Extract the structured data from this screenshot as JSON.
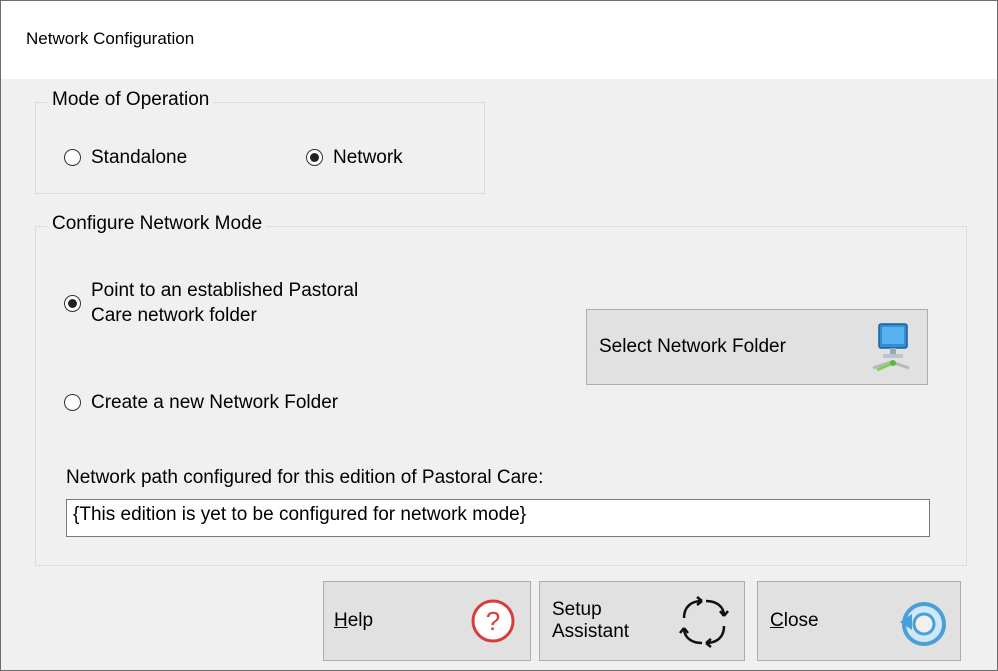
{
  "window": {
    "title": "Network Configuration"
  },
  "mode_group": {
    "legend": "Mode of Operation",
    "options": [
      {
        "label": "Standalone",
        "checked": false
      },
      {
        "label": "Network",
        "checked": true
      }
    ]
  },
  "configure_group": {
    "legend": "Configure Network Mode",
    "options": [
      {
        "label_line1": "Point to an established Pastoral",
        "label_line2": "Care network folder",
        "checked": true
      },
      {
        "label": "Create a new Network Folder",
        "checked": false
      }
    ],
    "select_button_label": "Select Network Folder",
    "path_label": "Network path configured for this edition of Pastoral Care:",
    "path_value": "{This edition is yet to be configured for network mode}"
  },
  "buttons": {
    "help": {
      "mnemonic": "H",
      "rest": "elp",
      "icon": "help-icon"
    },
    "setup": {
      "line1": "Setup",
      "line2": "Assistant",
      "icon": "refresh-arrows-icon"
    },
    "close": {
      "mnemonic": "C",
      "rest": "lose",
      "icon": "close-return-icon"
    }
  },
  "colors": {
    "help_icon": "#d93b3b",
    "close_icon": "#4a9fd6",
    "computer_icon": "#2f8fd9"
  }
}
